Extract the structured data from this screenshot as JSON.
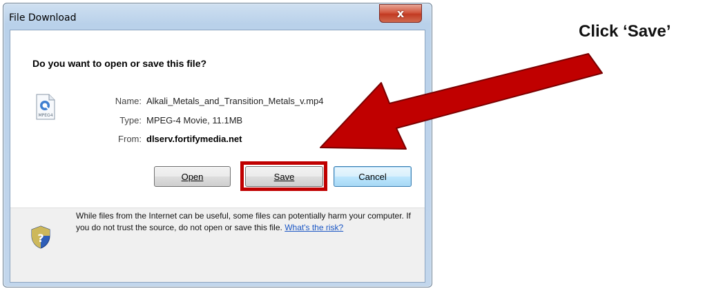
{
  "window": {
    "title": "File Download",
    "close_glyph": "x"
  },
  "dialog": {
    "question": "Do you want to open or save this file?",
    "file": {
      "icon": "mp4-file-icon",
      "icon_text": "MPEG4",
      "name_label": "Name:",
      "name_value": "Alkali_Metals_and_Transition_Metals_v.mp4",
      "type_label": "Type:",
      "type_value": "MPEG-4 Movie, 11.1MB",
      "from_label": "From:",
      "from_value": "dlserv.fortifymedia.net"
    },
    "buttons": {
      "open_label": "Open",
      "save_label": "Save",
      "cancel_label": "Cancel"
    },
    "footer": {
      "icon": "security-shield-icon",
      "warning_text": "While files from the Internet can be useful, some files can potentially harm your computer. If you do not trust the source, do not open or save this file.",
      "risk_link": "What's the risk?"
    }
  },
  "annotation": {
    "callout_text": "Click ‘Save’",
    "highlight_color": "#c00000",
    "arrow_color": "#c00000"
  }
}
